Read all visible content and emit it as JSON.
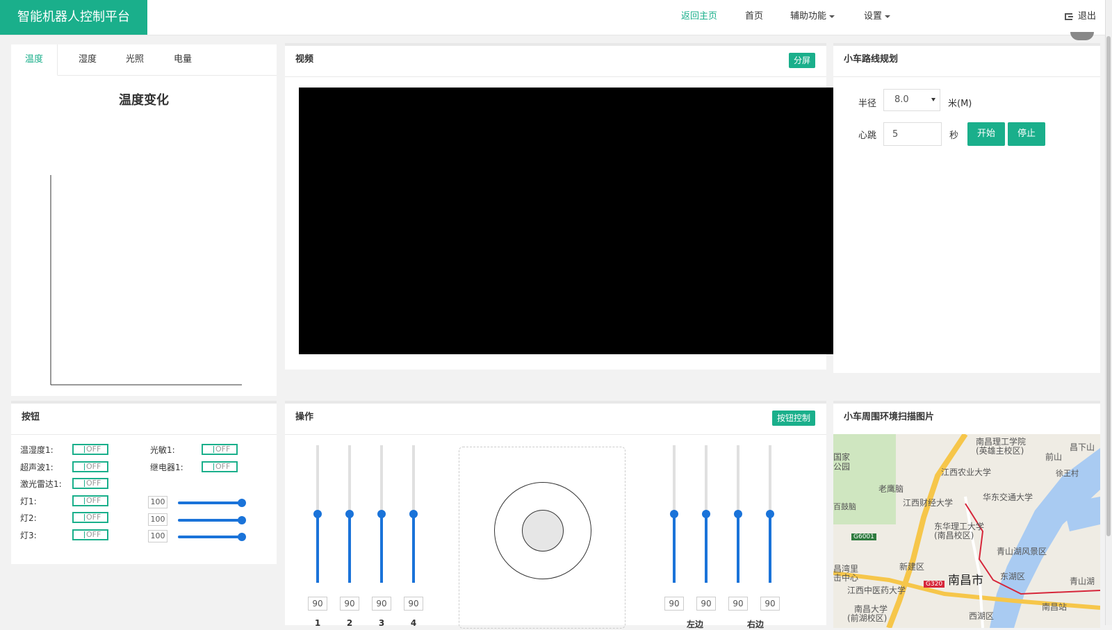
{
  "header": {
    "brand": "智能机器人控制平台",
    "nav": [
      "返回主页",
      "首页",
      "辅助功能",
      "设置"
    ],
    "logout": "退出"
  },
  "sensor_panel": {
    "tabs": [
      "温度",
      "湿度",
      "光照",
      "电量"
    ],
    "active_tab": "温度",
    "chart_title": "温度变化"
  },
  "video_panel": {
    "title": "视频",
    "split_button": "分屏"
  },
  "route_panel": {
    "title": "小车路线规划",
    "radius_label": "半径",
    "radius_value": "8.0",
    "radius_unit": "米(M)",
    "heartbeat_label": "心跳",
    "heartbeat_value": "5",
    "heartbeat_unit": "秒",
    "start_button": "开始",
    "stop_button": "停止"
  },
  "buttons_panel": {
    "title": "按钮",
    "switches_left": [
      {
        "label": "温湿度1:",
        "state": "OFF"
      },
      {
        "label": "超声波1:",
        "state": "OFF"
      },
      {
        "label": "激光雷达1:",
        "state": "OFF"
      },
      {
        "label": "灯1:",
        "state": "OFF"
      },
      {
        "label": "灯2:",
        "state": "OFF"
      },
      {
        "label": "灯3:",
        "state": "OFF"
      }
    ],
    "switches_right": [
      {
        "label": "光敏1:",
        "state": "OFF"
      },
      {
        "label": "继电器1:",
        "state": "OFF"
      }
    ],
    "lights": [
      {
        "value": "100",
        "level": 1.0
      },
      {
        "value": "100",
        "level": 1.0
      },
      {
        "value": "100",
        "level": 1.0
      }
    ]
  },
  "operation_panel": {
    "title": "操作",
    "control_button": "按钮控制",
    "left_sliders": [
      {
        "value": "90",
        "label": "1",
        "level": 0.5
      },
      {
        "value": "90",
        "label": "2",
        "level": 0.5
      },
      {
        "value": "90",
        "label": "3",
        "level": 0.5
      },
      {
        "value": "90",
        "label": "4",
        "level": 0.5
      }
    ],
    "right_sliders": [
      {
        "value": "90",
        "level": 0.5
      },
      {
        "value": "90",
        "level": 0.5
      },
      {
        "value": "90",
        "level": 0.5
      },
      {
        "value": "90",
        "level": 0.5
      }
    ],
    "right_labels": [
      "左边",
      "右边"
    ]
  },
  "map_panel": {
    "title": "小车周围环境扫描图片",
    "places": [
      "南昌理工学院",
      "(英雄主校区)",
      "江西农业大学",
      "老鹰脑",
      "华东交通大学",
      "江西财经大学",
      "东华理工大学",
      "(南昌校区)",
      "青山湖风景区",
      "新建区",
      "南昌市",
      "东湖区",
      "江西中医药大学",
      "南昌大学",
      "(前湖校区)",
      "西湖区",
      "南昌站",
      "青山湖",
      "前山",
      "徐王村",
      "国家",
      "公园",
      "百鼓脑",
      "G6001",
      "G320",
      "昌湾里",
      "击中心",
      "昌下山"
    ]
  }
}
